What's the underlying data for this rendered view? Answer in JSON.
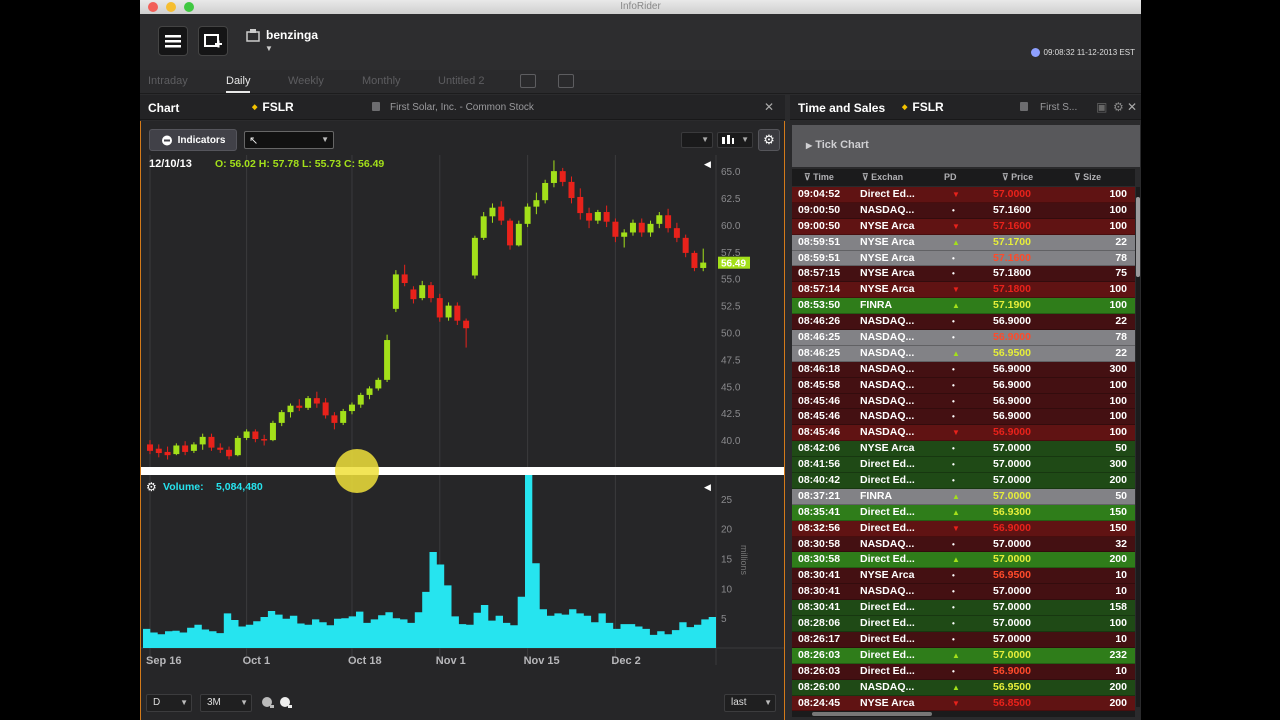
{
  "window": {
    "title": "InfoRider"
  },
  "brand": {
    "name": "benzinga"
  },
  "clock": "09:08:32 11-12-2013 EST",
  "tabs": [
    {
      "label": "Intraday",
      "active": false
    },
    {
      "label": "Daily",
      "active": true
    },
    {
      "label": "Weekly",
      "active": false
    },
    {
      "label": "Monthly",
      "active": false
    },
    {
      "label": "Untitled 2",
      "active": false
    }
  ],
  "chart_panel": {
    "title": "Chart",
    "symbol": "FSLR",
    "description": "First Solar, Inc. - Common Stock",
    "indicators_label": "Indicators",
    "ohlc_date": "12/10/13",
    "ohlc_text": "O: 56.02 H: 57.78 L: 55.73 C: 56.49",
    "volume_label": "Volume:",
    "volume_value": "5,084,480",
    "volume_unit": "millions",
    "period_select": "D",
    "range_select": "3M",
    "price_type_select": "last"
  },
  "ts_panel": {
    "title": "Time and Sales",
    "symbol": "FSLR",
    "description": "First S...",
    "tick_chart_label": "Tick Chart",
    "columns": [
      "Time",
      "Exchan",
      "PD",
      "Price",
      "Size"
    ]
  },
  "colors": {
    "up": "#a3e01a",
    "down": "#e8221b",
    "volume": "#26e4ef",
    "accent_border": "#d37a1a",
    "row_red": "#601313",
    "row_green": "#2f7d1a",
    "row_gray": "#828286",
    "row_dark_red": "#441012",
    "row_dark_green": "#1f4a16",
    "price_orange": "#ff4a2a",
    "price_yellow": "#e6ee3a"
  },
  "trades": [
    {
      "time": "09:04:52",
      "exchange": "Direct Ed...",
      "pd": "down",
      "price": "57.0000",
      "size": "100",
      "row": "red",
      "pc": "red"
    },
    {
      "time": "09:00:50",
      "exchange": "NASDAQ...",
      "pd": "dot",
      "price": "57.1600",
      "size": "100",
      "row": "dkred",
      "pc": "white"
    },
    {
      "time": "09:00:50",
      "exchange": "NYSE Arca",
      "pd": "down",
      "price": "57.1600",
      "size": "100",
      "row": "red",
      "pc": "red"
    },
    {
      "time": "08:59:51",
      "exchange": "NYSE Arca",
      "pd": "up",
      "price": "57.1700",
      "size": "22",
      "row": "gray",
      "pc": "yellow"
    },
    {
      "time": "08:59:51",
      "exchange": "NYSE Arca",
      "pd": "dot",
      "price": "57.1600",
      "size": "78",
      "row": "gray",
      "pc": "orange"
    },
    {
      "time": "08:57:15",
      "exchange": "NYSE Arca",
      "pd": "dot",
      "price": "57.1800",
      "size": "75",
      "row": "dkred",
      "pc": "white"
    },
    {
      "time": "08:57:14",
      "exchange": "NYSE Arca",
      "pd": "down",
      "price": "57.1800",
      "size": "100",
      "row": "red",
      "pc": "red"
    },
    {
      "time": "08:53:50",
      "exchange": "FINRA",
      "pd": "up",
      "price": "57.1900",
      "size": "100",
      "row": "green",
      "pc": "yellow"
    },
    {
      "time": "08:46:26",
      "exchange": "NASDAQ...",
      "pd": "dot",
      "price": "56.9000",
      "size": "22",
      "row": "dkred",
      "pc": "white"
    },
    {
      "time": "08:46:25",
      "exchange": "NASDAQ...",
      "pd": "dot",
      "price": "56.9000",
      "size": "78",
      "row": "gray",
      "pc": "orange"
    },
    {
      "time": "08:46:25",
      "exchange": "NASDAQ...",
      "pd": "up",
      "price": "56.9500",
      "size": "22",
      "row": "gray",
      "pc": "yellow"
    },
    {
      "time": "08:46:18",
      "exchange": "NASDAQ...",
      "pd": "dot",
      "price": "56.9000",
      "size": "300",
      "row": "dkred",
      "pc": "white"
    },
    {
      "time": "08:45:58",
      "exchange": "NASDAQ...",
      "pd": "dot",
      "price": "56.9000",
      "size": "100",
      "row": "dkred",
      "pc": "white"
    },
    {
      "time": "08:45:46",
      "exchange": "NASDAQ...",
      "pd": "dot",
      "price": "56.9000",
      "size": "100",
      "row": "dkred",
      "pc": "white"
    },
    {
      "time": "08:45:46",
      "exchange": "NASDAQ...",
      "pd": "dot",
      "price": "56.9000",
      "size": "100",
      "row": "dkred",
      "pc": "white"
    },
    {
      "time": "08:45:46",
      "exchange": "NASDAQ...",
      "pd": "down",
      "price": "56.9000",
      "size": "100",
      "row": "red",
      "pc": "red"
    },
    {
      "time": "08:42:06",
      "exchange": "NYSE Arca",
      "pd": "dot",
      "price": "57.0000",
      "size": "50",
      "row": "dkgreen",
      "pc": "white"
    },
    {
      "time": "08:41:56",
      "exchange": "Direct Ed...",
      "pd": "dot",
      "price": "57.0000",
      "size": "300",
      "row": "dkgreen",
      "pc": "white"
    },
    {
      "time": "08:40:42",
      "exchange": "Direct Ed...",
      "pd": "dot",
      "price": "57.0000",
      "size": "200",
      "row": "dkgreen",
      "pc": "white"
    },
    {
      "time": "08:37:21",
      "exchange": "FINRA",
      "pd": "up",
      "price": "57.0000",
      "size": "50",
      "row": "gray",
      "pc": "yellow"
    },
    {
      "time": "08:35:41",
      "exchange": "Direct Ed...",
      "pd": "up",
      "price": "56.9300",
      "size": "150",
      "row": "green",
      "pc": "yellow"
    },
    {
      "time": "08:32:56",
      "exchange": "Direct Ed...",
      "pd": "down",
      "price": "56.9000",
      "size": "150",
      "row": "red",
      "pc": "red"
    },
    {
      "time": "08:30:58",
      "exchange": "NASDAQ...",
      "pd": "dot",
      "price": "57.0000",
      "size": "32",
      "row": "dkred",
      "pc": "white"
    },
    {
      "time": "08:30:58",
      "exchange": "Direct Ed...",
      "pd": "up",
      "price": "57.0000",
      "size": "200",
      "row": "green",
      "pc": "yellow"
    },
    {
      "time": "08:30:41",
      "exchange": "NYSE Arca",
      "pd": "dot",
      "price": "56.9500",
      "size": "10",
      "row": "dkred",
      "pc": "orange"
    },
    {
      "time": "08:30:41",
      "exchange": "NASDAQ...",
      "pd": "dot",
      "price": "57.0000",
      "size": "10",
      "row": "dkred",
      "pc": "white"
    },
    {
      "time": "08:30:41",
      "exchange": "Direct Ed...",
      "pd": "dot",
      "price": "57.0000",
      "size": "158",
      "row": "dkgreen",
      "pc": "white"
    },
    {
      "time": "08:28:06",
      "exchange": "Direct Ed...",
      "pd": "dot",
      "price": "57.0000",
      "size": "100",
      "row": "dkgreen",
      "pc": "white"
    },
    {
      "time": "08:26:17",
      "exchange": "Direct Ed...",
      "pd": "dot",
      "price": "57.0000",
      "size": "10",
      "row": "dkred",
      "pc": "white"
    },
    {
      "time": "08:26:03",
      "exchange": "Direct Ed...",
      "pd": "up",
      "price": "57.0000",
      "size": "232",
      "row": "green",
      "pc": "yellow"
    },
    {
      "time": "08:26:03",
      "exchange": "Direct Ed...",
      "pd": "dot",
      "price": "56.9000",
      "size": "10",
      "row": "dkred",
      "pc": "orange"
    },
    {
      "time": "08:26:00",
      "exchange": "NASDAQ...",
      "pd": "up",
      "price": "56.9500",
      "size": "200",
      "row": "dkgreen",
      "pc": "yellow"
    },
    {
      "time": "08:24:45",
      "exchange": "NYSE Arca",
      "pd": "down",
      "price": "56.8500",
      "size": "200",
      "row": "red",
      "pc": "red"
    }
  ],
  "chart_data": {
    "type": "candlestick",
    "price_axis": {
      "ticks": [
        "40.0",
        "42.5",
        "45.0",
        "47.5",
        "50.0",
        "52.5",
        "55.0",
        "57.5",
        "60.0",
        "62.5",
        "65.0"
      ],
      "ylim": [
        37.5,
        66.5
      ]
    },
    "last_price_label": "56.49",
    "x_tick_labels": [
      "Sep 16",
      "Oct 1",
      "Oct 18",
      "Nov 1",
      "Nov 15",
      "Dec 2"
    ],
    "x_tick_index": [
      0,
      11,
      23,
      33,
      43,
      53
    ],
    "volume_axis": {
      "ticks": [
        "5",
        "10",
        "15",
        "20",
        "25"
      ],
      "ylim": [
        0,
        29
      ]
    },
    "candles": [
      {
        "o": 39.6,
        "h": 40.0,
        "l": 38.7,
        "c": 39.0
      },
      {
        "o": 39.2,
        "h": 39.6,
        "l": 38.4,
        "c": 38.8
      },
      {
        "o": 38.9,
        "h": 39.4,
        "l": 38.2,
        "c": 38.6
      },
      {
        "o": 38.7,
        "h": 39.7,
        "l": 38.6,
        "c": 39.5
      },
      {
        "o": 39.5,
        "h": 39.9,
        "l": 38.6,
        "c": 38.9
      },
      {
        "o": 39.0,
        "h": 39.8,
        "l": 38.8,
        "c": 39.6
      },
      {
        "o": 39.6,
        "h": 40.6,
        "l": 39.1,
        "c": 40.3
      },
      {
        "o": 40.3,
        "h": 40.6,
        "l": 39.0,
        "c": 39.3
      },
      {
        "o": 39.3,
        "h": 39.7,
        "l": 38.8,
        "c": 39.1
      },
      {
        "o": 39.1,
        "h": 39.4,
        "l": 38.2,
        "c": 38.5
      },
      {
        "o": 38.6,
        "h": 40.4,
        "l": 38.5,
        "c": 40.2
      },
      {
        "o": 40.2,
        "h": 41.0,
        "l": 40.0,
        "c": 40.8
      },
      {
        "o": 40.8,
        "h": 41.0,
        "l": 39.8,
        "c": 40.1
      },
      {
        "o": 40.1,
        "h": 40.5,
        "l": 39.5,
        "c": 40.0
      },
      {
        "o": 40.0,
        "h": 41.8,
        "l": 39.9,
        "c": 41.6
      },
      {
        "o": 41.6,
        "h": 42.8,
        "l": 41.3,
        "c": 42.6
      },
      {
        "o": 42.6,
        "h": 43.4,
        "l": 42.1,
        "c": 43.2
      },
      {
        "o": 43.2,
        "h": 43.8,
        "l": 42.7,
        "c": 43.0
      },
      {
        "o": 43.0,
        "h": 44.1,
        "l": 42.8,
        "c": 43.9
      },
      {
        "o": 43.9,
        "h": 44.5,
        "l": 43.0,
        "c": 43.4
      },
      {
        "o": 43.5,
        "h": 43.9,
        "l": 42.0,
        "c": 42.3
      },
      {
        "o": 42.3,
        "h": 42.6,
        "l": 41.0,
        "c": 41.6
      },
      {
        "o": 41.6,
        "h": 42.9,
        "l": 41.4,
        "c": 42.7
      },
      {
        "o": 42.7,
        "h": 43.5,
        "l": 42.4,
        "c": 43.3
      },
      {
        "o": 43.3,
        "h": 44.4,
        "l": 43.0,
        "c": 44.2
      },
      {
        "o": 44.2,
        "h": 45.0,
        "l": 43.8,
        "c": 44.8
      },
      {
        "o": 44.8,
        "h": 45.8,
        "l": 44.6,
        "c": 45.6
      },
      {
        "o": 45.6,
        "h": 49.8,
        "l": 45.4,
        "c": 49.3
      },
      {
        "o": 52.2,
        "h": 55.8,
        "l": 51.9,
        "c": 55.4
      },
      {
        "o": 55.4,
        "h": 56.3,
        "l": 54.3,
        "c": 54.6
      },
      {
        "o": 54.0,
        "h": 54.3,
        "l": 52.7,
        "c": 53.1
      },
      {
        "o": 53.2,
        "h": 54.8,
        "l": 53.0,
        "c": 54.4
      },
      {
        "o": 54.4,
        "h": 54.7,
        "l": 52.8,
        "c": 53.2
      },
      {
        "o": 53.2,
        "h": 53.6,
        "l": 51.0,
        "c": 51.4
      },
      {
        "o": 51.4,
        "h": 52.8,
        "l": 51.1,
        "c": 52.5
      },
      {
        "o": 52.5,
        "h": 52.8,
        "l": 50.7,
        "c": 51.1
      },
      {
        "o": 51.1,
        "h": 51.3,
        "l": 48.6,
        "c": 50.4
      },
      {
        "o": 55.3,
        "h": 59.0,
        "l": 55.0,
        "c": 58.8
      },
      {
        "o": 58.8,
        "h": 61.2,
        "l": 58.6,
        "c": 60.8
      },
      {
        "o": 60.8,
        "h": 62.0,
        "l": 60.2,
        "c": 61.6
      },
      {
        "o": 61.7,
        "h": 62.2,
        "l": 60.0,
        "c": 60.4
      },
      {
        "o": 60.4,
        "h": 60.6,
        "l": 57.7,
        "c": 58.1
      },
      {
        "o": 58.1,
        "h": 60.4,
        "l": 58.0,
        "c": 60.1
      },
      {
        "o": 60.1,
        "h": 62.0,
        "l": 59.8,
        "c": 61.7
      },
      {
        "o": 61.7,
        "h": 63.0,
        "l": 61.0,
        "c": 62.3
      },
      {
        "o": 62.3,
        "h": 64.2,
        "l": 62.0,
        "c": 63.9
      },
      {
        "o": 63.9,
        "h": 66.0,
        "l": 63.5,
        "c": 65.0
      },
      {
        "o": 65.0,
        "h": 65.3,
        "l": 63.6,
        "c": 64.0
      },
      {
        "o": 64.0,
        "h": 64.5,
        "l": 62.0,
        "c": 62.5
      },
      {
        "o": 62.6,
        "h": 63.4,
        "l": 60.5,
        "c": 61.1
      },
      {
        "o": 61.1,
        "h": 61.6,
        "l": 59.7,
        "c": 60.4
      },
      {
        "o": 60.4,
        "h": 61.4,
        "l": 60.1,
        "c": 61.2
      },
      {
        "o": 61.2,
        "h": 61.8,
        "l": 59.8,
        "c": 60.3
      },
      {
        "o": 60.3,
        "h": 60.6,
        "l": 58.4,
        "c": 58.9
      },
      {
        "o": 58.9,
        "h": 59.6,
        "l": 57.9,
        "c": 59.3
      },
      {
        "o": 59.3,
        "h": 60.5,
        "l": 59.0,
        "c": 60.2
      },
      {
        "o": 60.2,
        "h": 60.6,
        "l": 58.9,
        "c": 59.3
      },
      {
        "o": 59.3,
        "h": 60.4,
        "l": 58.9,
        "c": 60.1
      },
      {
        "o": 60.1,
        "h": 61.2,
        "l": 59.7,
        "c": 60.9
      },
      {
        "o": 60.9,
        "h": 61.5,
        "l": 59.3,
        "c": 59.7
      },
      {
        "o": 59.7,
        "h": 60.2,
        "l": 58.4,
        "c": 58.8
      },
      {
        "o": 58.8,
        "h": 59.1,
        "l": 57.0,
        "c": 57.4
      },
      {
        "o": 57.4,
        "h": 57.6,
        "l": 55.7,
        "c": 56.0
      },
      {
        "o": 56.0,
        "h": 57.8,
        "l": 55.7,
        "c": 56.5
      }
    ],
    "volumes": [
      3.2,
      2.6,
      2.3,
      2.8,
      2.9,
      2.6,
      3.4,
      3.9,
      3.1,
      2.8,
      2.5,
      5.8,
      4.7,
      3.6,
      3.9,
      4.5,
      5.2,
      6.2,
      5.6,
      4.9,
      5.4,
      4.1,
      3.9,
      4.8,
      4.3,
      3.8,
      4.9,
      5.0,
      5.3,
      6.1,
      4.2,
      4.8,
      5.5,
      6.0,
      5.0,
      4.8,
      4.2,
      6.0,
      9.4,
      16.1,
      14.0,
      10.5,
      5.3,
      4.0,
      3.9,
      5.9,
      7.2,
      4.6,
      5.4,
      4.2,
      3.8,
      8.6,
      29.1,
      14.2,
      6.5,
      5.4,
      5.8,
      5.6,
      6.5,
      5.8,
      5.4,
      4.3,
      5.8,
      4.2,
      3.2,
      4.0,
      4.0,
      3.6,
      3.2,
      2.2,
      2.8,
      2.3,
      3.0,
      4.3,
      3.5,
      3.9,
      4.8,
      5.2
    ]
  }
}
